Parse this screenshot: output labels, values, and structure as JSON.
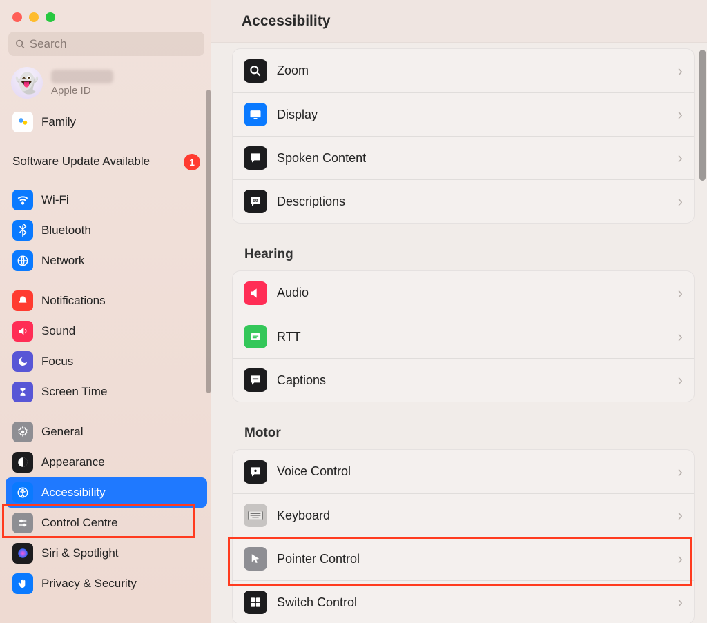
{
  "window": {
    "title": "Accessibility"
  },
  "search": {
    "placeholder": "Search"
  },
  "account": {
    "apple_id_label": "Apple ID",
    "avatar_emoji": "👻"
  },
  "sidebar": {
    "family_label": "Family",
    "update_label": "Software Update Available",
    "update_badge": "1",
    "groups": [
      {
        "items": [
          {
            "id": "wifi",
            "label": "Wi-Fi",
            "icon": "wifi-icon",
            "color": "#0a7aff"
          },
          {
            "id": "bluetooth",
            "label": "Bluetooth",
            "icon": "bluetooth-icon",
            "color": "#0a7aff"
          },
          {
            "id": "network",
            "label": "Network",
            "icon": "network-icon",
            "color": "#0a7aff"
          }
        ]
      },
      {
        "items": [
          {
            "id": "notifications",
            "label": "Notifications",
            "icon": "bell-icon",
            "color": "#ff3b30"
          },
          {
            "id": "sound",
            "label": "Sound",
            "icon": "sound-icon",
            "color": "#ff2d55"
          },
          {
            "id": "focus",
            "label": "Focus",
            "icon": "moon-icon",
            "color": "#5856d6"
          },
          {
            "id": "screentime",
            "label": "Screen Time",
            "icon": "hourglass-icon",
            "color": "#5856d6"
          }
        ]
      },
      {
        "items": [
          {
            "id": "general",
            "label": "General",
            "icon": "gear-icon",
            "color": "#8e8e93"
          },
          {
            "id": "appearance",
            "label": "Appearance",
            "icon": "appearance-icon",
            "color": "#1c1c1e"
          },
          {
            "id": "accessibility",
            "label": "Accessibility",
            "icon": "accessibility-icon",
            "color": "#0a7aff",
            "selected": true
          },
          {
            "id": "controlcentre",
            "label": "Control Centre",
            "icon": "switches-icon",
            "color": "#8e8e93"
          },
          {
            "id": "siri",
            "label": "Siri & Spotlight",
            "icon": "siri-icon",
            "color": "#1c1c1e"
          },
          {
            "id": "privacy",
            "label": "Privacy & Security",
            "icon": "hand-icon",
            "color": "#0a7aff"
          }
        ]
      }
    ]
  },
  "main": {
    "first_card": [
      {
        "id": "zoom",
        "label": "Zoom",
        "icon": "zoom-icon",
        "color": "#1c1c1e"
      },
      {
        "id": "display",
        "label": "Display",
        "icon": "display-icon",
        "color": "#0a7aff"
      },
      {
        "id": "spoken",
        "label": "Spoken Content",
        "icon": "speech-icon",
        "color": "#1c1c1e"
      },
      {
        "id": "descriptions",
        "label": "Descriptions",
        "icon": "caption-icon",
        "color": "#1c1c1e"
      }
    ],
    "hearing_label": "Hearing",
    "hearing_card": [
      {
        "id": "audio",
        "label": "Audio",
        "icon": "audio-icon",
        "color": "#ff2d55"
      },
      {
        "id": "rtt",
        "label": "RTT",
        "icon": "rtt-icon",
        "color": "#34c759"
      },
      {
        "id": "captions",
        "label": "Captions",
        "icon": "captions2-icon",
        "color": "#1c1c1e"
      }
    ],
    "motor_label": "Motor",
    "motor_card": [
      {
        "id": "voicecontrol",
        "label": "Voice Control",
        "icon": "voice-icon",
        "color": "#1c1c1e"
      },
      {
        "id": "keyboard",
        "label": "Keyboard",
        "icon": "keyboard-icon",
        "color": "#c7c4c2"
      },
      {
        "id": "pointercontrol",
        "label": "Pointer Control",
        "icon": "pointer-icon",
        "color": "#8e8e93"
      },
      {
        "id": "switchcontrol",
        "label": "Switch Control",
        "icon": "switch-icon",
        "color": "#1c1c1e"
      }
    ]
  }
}
